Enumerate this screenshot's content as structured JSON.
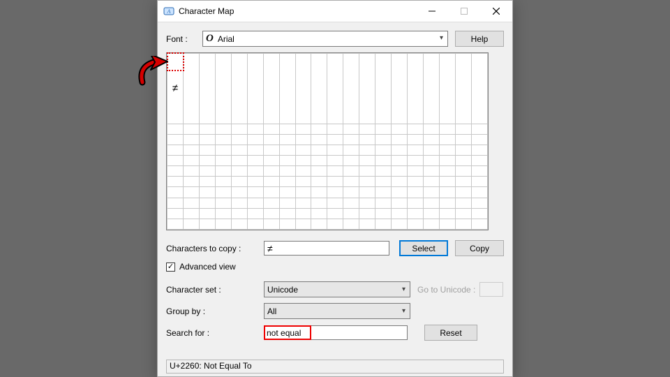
{
  "titlebar": {
    "title": "Character Map"
  },
  "font_row": {
    "label": "Font :",
    "value": "Arial",
    "help": "Help"
  },
  "grid": {
    "first_char": "≠"
  },
  "copy_row": {
    "label": "Characters to copy :",
    "value": "≠",
    "select": "Select",
    "copy": "Copy"
  },
  "advanced": {
    "label": "Advanced view",
    "checked": "✓"
  },
  "charset_row": {
    "label": "Character set :",
    "value": "Unicode",
    "goto_label": "Go to Unicode :",
    "goto_value": ""
  },
  "group_row": {
    "label": "Group by :",
    "value": "All"
  },
  "search_row": {
    "label": "Search for :",
    "value": "not equal",
    "reset": "Reset"
  },
  "status": "U+2260: Not Equal To"
}
